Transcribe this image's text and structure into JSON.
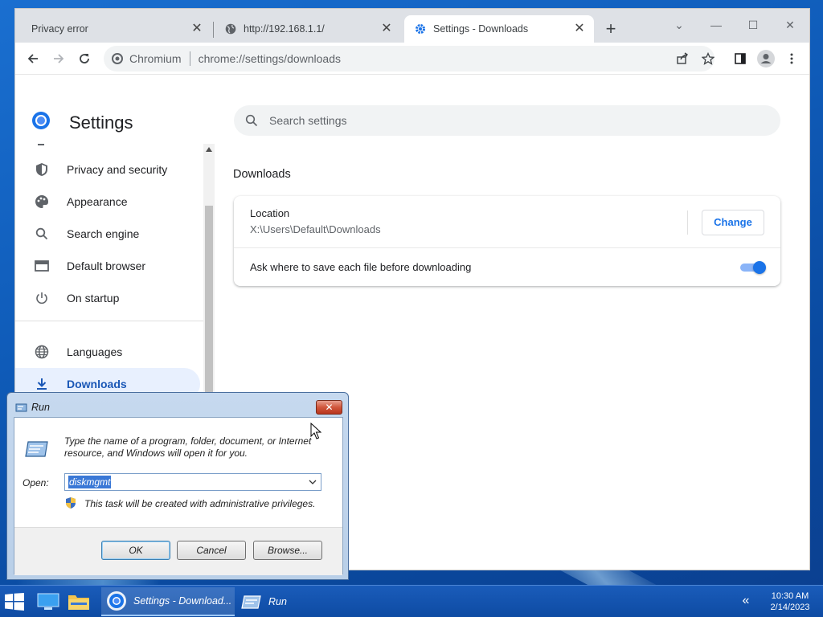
{
  "browser": {
    "tabs": [
      {
        "label": "Privacy error",
        "active": false
      },
      {
        "label": "http://192.168.1.1/",
        "active": false
      },
      {
        "label": "Settings - Downloads",
        "active": true
      }
    ],
    "new_tab_symbol": "+",
    "omnibox": {
      "site": "Chromium",
      "url": "chrome://settings/downloads"
    },
    "window_controls": {
      "tabsearch": "⌄",
      "minimize": "—",
      "maximize": "☐",
      "close": "✕"
    }
  },
  "settings": {
    "title": "Settings",
    "search": {
      "placeholder": "Search settings"
    },
    "nav": [
      {
        "label": "Privacy and security",
        "icon": "shield-icon",
        "selected": false
      },
      {
        "label": "Appearance",
        "icon": "palette-icon",
        "selected": false
      },
      {
        "label": "Search engine",
        "icon": "search-icon",
        "selected": false
      },
      {
        "label": "Default browser",
        "icon": "browser-icon",
        "selected": false
      },
      {
        "label": "On startup",
        "icon": "power-icon",
        "selected": false
      },
      {
        "label": "Languages",
        "icon": "globe-icon",
        "selected": false
      },
      {
        "label": "Downloads",
        "icon": "download-icon",
        "selected": true
      }
    ],
    "section_title": "Downloads",
    "location": {
      "label": "Location",
      "path": "X:\\Users\\Default\\Downloads",
      "button": "Change"
    },
    "ask_where": {
      "label": "Ask where to save each file before downloading",
      "enabled": true
    }
  },
  "run_dialog": {
    "title": "Run",
    "close_symbol": "✕",
    "description": "Type the name of a program, folder, document, or Internet resource, and Windows will open it for you.",
    "open_label": "Open:",
    "open_value": "diskmgmt",
    "admin_note": "This task will be created with administrative privileges.",
    "buttons": {
      "ok": "OK",
      "cancel": "Cancel",
      "browse": "Browse..."
    }
  },
  "taskbar": {
    "tasks": [
      {
        "label": "Settings - Download...",
        "icon": "chromium-icon",
        "active": true
      },
      {
        "label": "Run",
        "icon": "run-icon",
        "active": false
      }
    ],
    "tray_chevron": "«",
    "clock": {
      "time": "10:30 AM",
      "date": "2/14/2023"
    }
  },
  "colors": {
    "accent": "#1a73e8",
    "selected_nav_bg": "#e8f0fe",
    "taskbar": "#1a5cba",
    "desktop": "#0f5bb8"
  }
}
